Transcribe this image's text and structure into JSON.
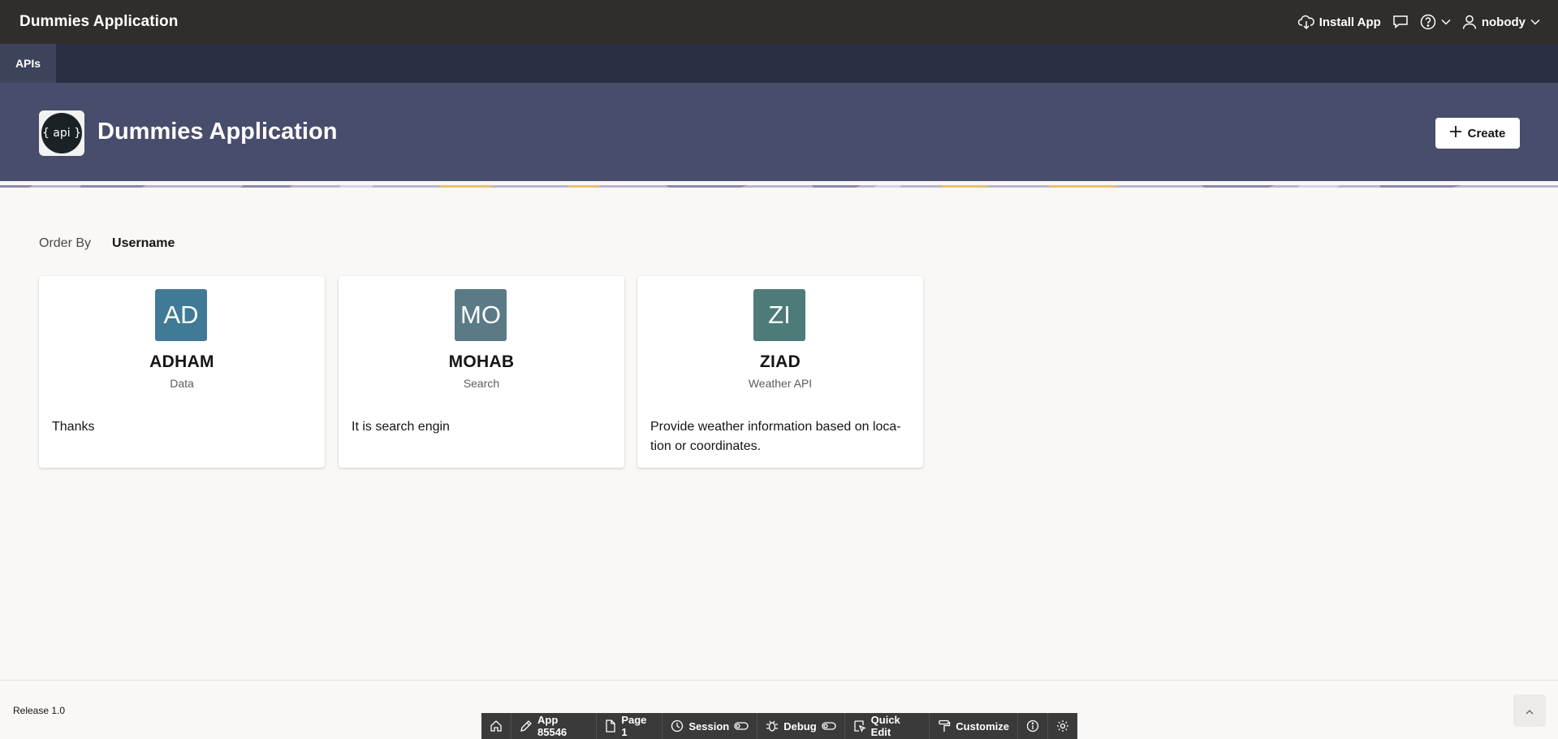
{
  "header": {
    "app_title": "Dummies Application",
    "install_app_label": "Install App",
    "user_name": "nobody"
  },
  "tabs": [
    {
      "label": "APIs"
    }
  ],
  "hero": {
    "logo_text": "{ api }",
    "title": "Dummies Application",
    "create_label": "Create"
  },
  "order_by": {
    "label": "Order By",
    "value": "Username"
  },
  "cards": [
    {
      "initials": "AD",
      "title": "ADHAM",
      "subtitle": "Data",
      "description": "Thanks",
      "badge_color": "#407a96"
    },
    {
      "initials": "MO",
      "title": "MOHAB",
      "subtitle": "Search",
      "description": "It is search engin",
      "badge_color": "#5a7a85"
    },
    {
      "initials": "ZI",
      "title": "ZIAD",
      "subtitle": "Weather API",
      "description": "Provide weather information based on loca-tion or coordinates.",
      "badge_color": "#4d7b77"
    }
  ],
  "footer": {
    "release": "Release 1.0"
  },
  "dev_toolbar": {
    "app_label": "App 85546",
    "page_label": "Page 1",
    "session_label": "Session",
    "debug_label": "Debug",
    "quick_edit_label": "Quick Edit",
    "customize_label": "Customize"
  }
}
